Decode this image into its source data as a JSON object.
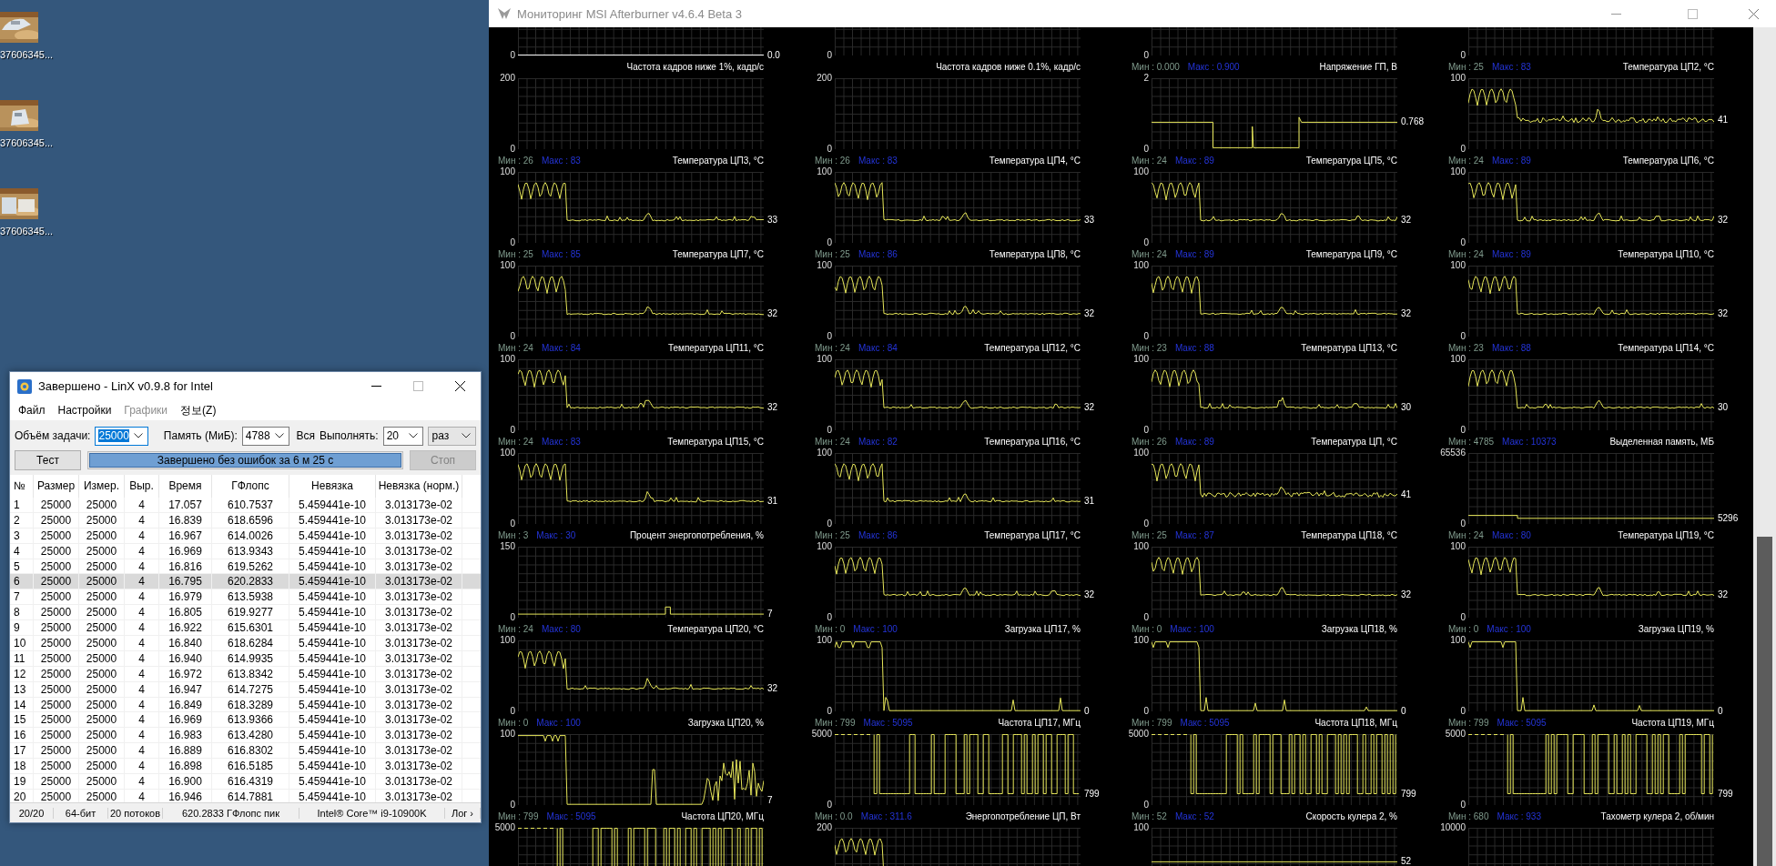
{
  "desktop_icons": [
    {
      "label": "37606345..."
    },
    {
      "label": "37606345..."
    },
    {
      "label": "37606345..."
    }
  ],
  "linx": {
    "title": "Завершено - LinX v0.9.8 for Intel",
    "menu": [
      {
        "label": "Файл",
        "disabled": false
      },
      {
        "label": "Настройки",
        "disabled": false
      },
      {
        "label": "Графики",
        "disabled": true
      },
      {
        "label": "정보(Z)",
        "disabled": false
      }
    ],
    "controls": [
      {
        "kind": "label",
        "text": "Объём задачи:"
      },
      {
        "kind": "combo",
        "value": "25000",
        "focused": true
      },
      {
        "kind": "label",
        "text": "Память (МиБ):"
      },
      {
        "kind": "combo",
        "value": "4788",
        "focused": false
      },
      {
        "kind": "label",
        "text": "Вся"
      },
      {
        "kind": "label",
        "text": "Выполнять:"
      },
      {
        "kind": "combo",
        "value": "20",
        "focused": false
      },
      {
        "kind": "dropdown",
        "value": "раз",
        "focused": false
      }
    ],
    "test_button": {
      "label": "Тест",
      "disabled": false
    },
    "progress": {
      "text": "Завершено без ошибок за 6 м 25 с",
      "level": 1
    },
    "stop_button": {
      "label": "Стоп",
      "disabled": true
    },
    "table": {
      "columns": [
        "№",
        "Размер",
        "Измер.",
        "Выр.",
        "Время",
        "ГФлопс",
        "Невязка",
        "Невязка (норм.)"
      ],
      "rows": [
        {
          "cells": [
            "1",
            "25000",
            "25000",
            "4",
            "17.057",
            "610.7537",
            "5.459441e-10",
            "3.013173e-02"
          ],
          "selected": false
        },
        {
          "cells": [
            "2",
            "25000",
            "25000",
            "4",
            "16.839",
            "618.6596",
            "5.459441e-10",
            "3.013173e-02"
          ],
          "selected": false
        },
        {
          "cells": [
            "3",
            "25000",
            "25000",
            "4",
            "16.967",
            "614.0026",
            "5.459441e-10",
            "3.013173e-02"
          ],
          "selected": false
        },
        {
          "cells": [
            "4",
            "25000",
            "25000",
            "4",
            "16.969",
            "613.9343",
            "5.459441e-10",
            "3.013173e-02"
          ],
          "selected": false
        },
        {
          "cells": [
            "5",
            "25000",
            "25000",
            "4",
            "16.816",
            "619.5262",
            "5.459441e-10",
            "3.013173e-02"
          ],
          "selected": false
        },
        {
          "cells": [
            "6",
            "25000",
            "25000",
            "4",
            "16.795",
            "620.2833",
            "5.459441e-10",
            "3.013173e-02"
          ],
          "selected": true
        },
        {
          "cells": [
            "7",
            "25000",
            "25000",
            "4",
            "16.979",
            "613.5938",
            "5.459441e-10",
            "3.013173e-02"
          ],
          "selected": false
        },
        {
          "cells": [
            "8",
            "25000",
            "25000",
            "4",
            "16.805",
            "619.9277",
            "5.459441e-10",
            "3.013173e-02"
          ],
          "selected": false
        },
        {
          "cells": [
            "9",
            "25000",
            "25000",
            "4",
            "16.922",
            "615.6301",
            "5.459441e-10",
            "3.013173e-02"
          ],
          "selected": false
        },
        {
          "cells": [
            "10",
            "25000",
            "25000",
            "4",
            "16.840",
            "618.6284",
            "5.459441e-10",
            "3.013173e-02"
          ],
          "selected": false
        },
        {
          "cells": [
            "11",
            "25000",
            "25000",
            "4",
            "16.940",
            "614.9935",
            "5.459441e-10",
            "3.013173e-02"
          ],
          "selected": false
        },
        {
          "cells": [
            "12",
            "25000",
            "25000",
            "4",
            "16.972",
            "613.8342",
            "5.459441e-10",
            "3.013173e-02"
          ],
          "selected": false
        },
        {
          "cells": [
            "13",
            "25000",
            "25000",
            "4",
            "16.947",
            "614.7275",
            "5.459441e-10",
            "3.013173e-02"
          ],
          "selected": false
        },
        {
          "cells": [
            "14",
            "25000",
            "25000",
            "4",
            "16.849",
            "618.3289",
            "5.459441e-10",
            "3.013173e-02"
          ],
          "selected": false
        },
        {
          "cells": [
            "15",
            "25000",
            "25000",
            "4",
            "16.969",
            "613.9366",
            "5.459441e-10",
            "3.013173e-02"
          ],
          "selected": false
        },
        {
          "cells": [
            "16",
            "25000",
            "25000",
            "4",
            "16.983",
            "613.4280",
            "5.459441e-10",
            "3.013173e-02"
          ],
          "selected": false
        },
        {
          "cells": [
            "17",
            "25000",
            "25000",
            "4",
            "16.889",
            "616.8302",
            "5.459441e-10",
            "3.013173e-02"
          ],
          "selected": false
        },
        {
          "cells": [
            "18",
            "25000",
            "25000",
            "4",
            "16.898",
            "616.5185",
            "5.459441e-10",
            "3.013173e-02"
          ],
          "selected": false
        },
        {
          "cells": [
            "19",
            "25000",
            "25000",
            "4",
            "16.900",
            "616.4319",
            "5.459441e-10",
            "3.013173e-02"
          ],
          "selected": false
        },
        {
          "cells": [
            "20",
            "25000",
            "25000",
            "4",
            "16.946",
            "614.7881",
            "5.459441e-10",
            "3.013173e-02"
          ],
          "selected": false
        }
      ]
    },
    "status_bar": [
      "20/20",
      "64-бит",
      "20 потоков",
      "620.2833 ГФлопс пик",
      "Intel® Core™ i9-10900K",
      "Лог ›"
    ]
  },
  "afterburner": {
    "title": "Мониторинг MSI Afterburner v4.6.4 Beta 3",
    "columns": [
      {
        "top": {
          "bottom_label": "0",
          "value": "0.0",
          "kind": "zero"
        },
        "graphs": [
          {
            "title": "Частота кадров ниже 1%, кадр/с",
            "top_label": "200",
            "bottom_label": "0",
            "kind": "empty"
          },
          {
            "min": "Мин : 26",
            "max": "Макс : 83",
            "title": "Температура ЦП3, °C",
            "top_label": "100",
            "bottom_label": "0",
            "value": "33",
            "kind": "temp"
          },
          {
            "min": "Мин : 25",
            "max": "Макс : 85",
            "title": "Температура ЦП7, °C",
            "top_label": "100",
            "bottom_label": "0",
            "value": "32",
            "kind": "temp"
          },
          {
            "min": "Мин : 24",
            "max": "Макс : 84",
            "title": "Температура ЦП11, °C",
            "top_label": "100",
            "bottom_label": "0",
            "value": "32",
            "kind": "temp"
          },
          {
            "min": "Мин : 24",
            "max": "Макс : 83",
            "title": "Температура ЦП15, °C",
            "top_label": "100",
            "bottom_label": "0",
            "value": "31",
            "kind": "temp"
          },
          {
            "min": "Мин : 3",
            "max": "Макс : 30",
            "title": "Процент энергопотребления, %",
            "top_label": "150",
            "bottom_label": "0",
            "value": "7",
            "kind": "power"
          },
          {
            "min": "Мин : 24",
            "max": "Макс : 80",
            "title": "Температура ЦП20, °C",
            "top_label": "100",
            "bottom_label": "0",
            "value": "32",
            "kind": "temp"
          },
          {
            "min": "Мин : 0",
            "max": "Макс : 100",
            "title": "Загрузка ЦП20, %",
            "top_label": "100",
            "bottom_label": "0",
            "value": "7",
            "kind": "load-active"
          },
          {
            "min": "Мин : 799",
            "max": "Макс : 5095",
            "title": "Частота ЦП20, МГц",
            "top_label": "5000",
            "kind": "freq"
          }
        ]
      },
      {
        "top": {
          "bottom_label": "0",
          "kind": "empty"
        },
        "graphs": [
          {
            "title": "Частота кадров ниже 0.1%, кадр/с",
            "top_label": "200",
            "bottom_label": "0",
            "kind": "empty"
          },
          {
            "min": "Мин : 26",
            "max": "Макс : 83",
            "title": "Температура ЦП4, °C",
            "top_label": "100",
            "bottom_label": "0",
            "value": "33",
            "kind": "temp"
          },
          {
            "min": "Мин : 25",
            "max": "Макс : 86",
            "title": "Температура ЦП8, °C",
            "top_label": "100",
            "bottom_label": "0",
            "value": "32",
            "kind": "temp"
          },
          {
            "min": "Мин : 24",
            "max": "Макс : 84",
            "title": "Температура ЦП12, °C",
            "top_label": "100",
            "bottom_label": "0",
            "value": "32",
            "kind": "temp"
          },
          {
            "min": "Мин : 24",
            "max": "Макс : 82",
            "title": "Температура ЦП16, °C",
            "top_label": "100",
            "bottom_label": "0",
            "value": "31",
            "kind": "temp"
          },
          {
            "min": "Мин : 25",
            "max": "Макс : 86",
            "title": "Температура ЦП17, °C",
            "top_label": "100",
            "bottom_label": "0",
            "value": "32",
            "kind": "temp"
          },
          {
            "min": "Мин : 0",
            "max": "Макс : 100",
            "title": "Загрузка ЦП17, %",
            "top_label": "100",
            "bottom_label": "0",
            "value": "0",
            "kind": "load"
          },
          {
            "min": "Мин : 799",
            "max": "Макс : 5095",
            "title": "Частота ЦП17, МГц",
            "top_label": "5000",
            "bottom_label": "0",
            "value": "799",
            "kind": "freq"
          },
          {
            "min": "Мин : 0.0",
            "max": "Макс : 311.6",
            "title": "Энергопотребление ЦП, Вт",
            "top_label": "200",
            "kind": "temp"
          }
        ]
      },
      {
        "top": {
          "bottom_label": "0",
          "kind": "empty"
        },
        "graphs": [
          {
            "min": "Мин : 0.000",
            "max": "Макс : 0.900",
            "title": "Напряжение ГП, В",
            "top_label": "2",
            "bottom_label": "0",
            "value": "0.768",
            "kind": "voltage"
          },
          {
            "min": "Мин : 24",
            "max": "Макс : 89",
            "title": "Температура ЦП5, °C",
            "top_label": "100",
            "bottom_label": "0",
            "value": "32",
            "kind": "temp"
          },
          {
            "min": "Мин : 24",
            "max": "Макс : 89",
            "title": "Температура ЦП9, °C",
            "top_label": "100",
            "bottom_label": "0",
            "value": "32",
            "kind": "temp"
          },
          {
            "min": "Мин : 23",
            "max": "Макс : 88",
            "title": "Температура ЦП13, °C",
            "top_label": "100",
            "bottom_label": "0",
            "value": "30",
            "kind": "temp"
          },
          {
            "min": "Мин : 26",
            "max": "Макс : 89",
            "title": "Температура ЦП, °C",
            "top_label": "100",
            "bottom_label": "0",
            "value": "41",
            "kind": "temp-noisy"
          },
          {
            "min": "Мин : 25",
            "max": "Макс : 87",
            "title": "Температура ЦП18, °C",
            "top_label": "100",
            "bottom_label": "0",
            "value": "32",
            "kind": "temp"
          },
          {
            "min": "Мин : 0",
            "max": "Макс : 100",
            "title": "Загрузка ЦП18, %",
            "top_label": "100",
            "bottom_label": "0",
            "value": "0",
            "kind": "load"
          },
          {
            "min": "Мин : 799",
            "max": "Макс : 5095",
            "title": "Частота ЦП18, МГц",
            "top_label": "5000",
            "bottom_label": "0",
            "value": "799",
            "kind": "freq"
          },
          {
            "min": "Мин : 52",
            "max": "Макс : 52",
            "title": "Скорость кулера 2, %",
            "top_label": "100",
            "value": "52",
            "kind": "fan"
          }
        ]
      },
      {
        "top": {
          "bottom_label": "0",
          "kind": "empty"
        },
        "graphs": [
          {
            "min": "Мин : 25",
            "max": "Макс : 83",
            "title": "Температура ЦП2, °C",
            "top_label": "100",
            "bottom_label": "0",
            "value": "41",
            "kind": "temp-noisy"
          },
          {
            "min": "Мин : 24",
            "max": "Макс : 89",
            "title": "Температура ЦП6, °C",
            "top_label": "100",
            "bottom_label": "0",
            "value": "32",
            "kind": "temp"
          },
          {
            "min": "Мин : 24",
            "max": "Макс : 89",
            "title": "Температура ЦП10, °C",
            "top_label": "100",
            "bottom_label": "0",
            "value": "32",
            "kind": "temp"
          },
          {
            "min": "Мин : 23",
            "max": "Макс : 88",
            "title": "Температура ЦП14, °C",
            "top_label": "100",
            "bottom_label": "0",
            "value": "30",
            "kind": "temp"
          },
          {
            "min": "Мин : 4785",
            "max": "Макс : 10373",
            "title": "Выделенная память, МБ",
            "top_label": "65536",
            "bottom_label": "0",
            "value": "5296",
            "kind": "memory"
          },
          {
            "min": "Мин : 24",
            "max": "Макс : 80",
            "title": "Температура ЦП19, °C",
            "top_label": "100",
            "bottom_label": "0",
            "value": "32",
            "kind": "temp"
          },
          {
            "min": "Мин : 0",
            "max": "Макс : 100",
            "title": "Загрузка ЦП19, %",
            "top_label": "100",
            "bottom_label": "0",
            "value": "0",
            "kind": "load"
          },
          {
            "min": "Мин : 799",
            "max": "Макс : 5095",
            "title": "Частота ЦП19, МГц",
            "top_label": "5000",
            "bottom_label": "0",
            "value": "799",
            "kind": "freq"
          },
          {
            "min": "Мин : 680",
            "max": "Макс : 933",
            "title": "Тахометр кулера 2, об/мин",
            "top_label": "10000",
            "kind": "tach"
          }
        ]
      }
    ]
  }
}
